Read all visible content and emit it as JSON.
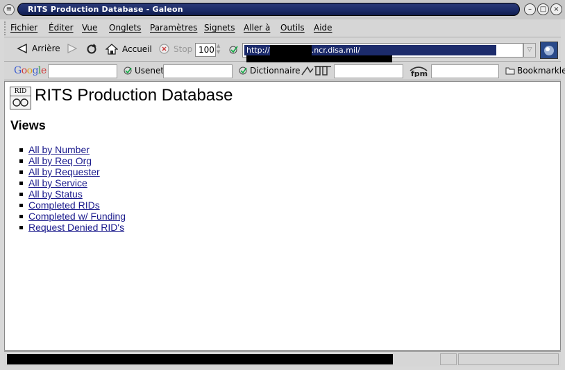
{
  "window": {
    "title": "RITS Production Database - Galeon"
  },
  "menubar": {
    "items": [
      "Fichier",
      "Éditer",
      "Vue",
      "Onglets",
      "Paramètres",
      "Signets",
      "Aller à",
      "Outils",
      "Aide"
    ]
  },
  "toolbar": {
    "back_label": "Arrière",
    "home_label": "Accueil",
    "stop_label": "Stop",
    "zoom_value": "100",
    "url_prefix": "http://",
    "url_visible_part": ".ncr.disa.mil/"
  },
  "searchbar": {
    "google_label": "Google",
    "usenet_label": "Usenet",
    "dictionary_label": "Dictionnaire",
    "fpm_label": "fpm",
    "bookmarks_label": "Bookmarkle"
  },
  "page": {
    "logo_text": "RID",
    "title": "RITS Production Database",
    "views_heading": "Views",
    "views": [
      "All by Number",
      "All by Req Org",
      "All by Requester",
      "All by Service",
      "All by Status",
      "Completed RIDs",
      "Completed w/ Funding",
      "Request Denied RID's"
    ]
  },
  "colors": {
    "title_bar": "#1a2a66",
    "link": "#1a1a8c",
    "url_selection": "#1c2b6b"
  }
}
